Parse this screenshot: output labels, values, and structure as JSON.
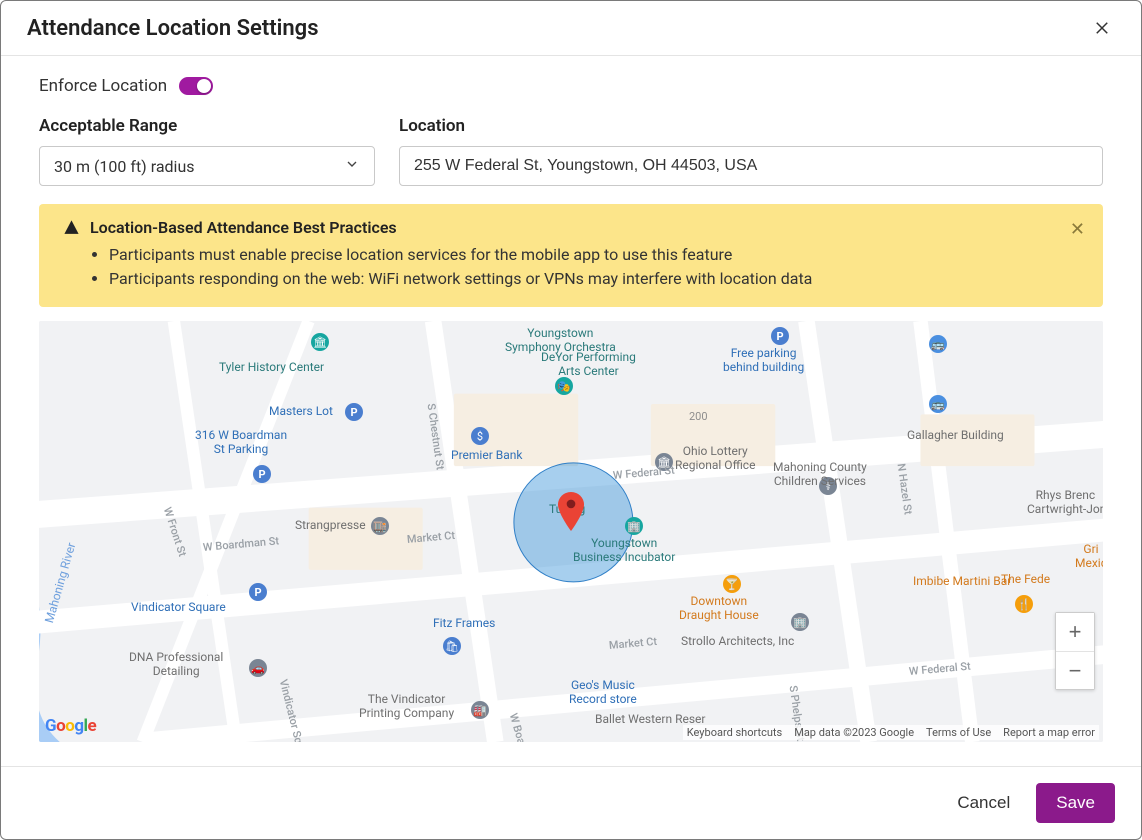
{
  "header": {
    "title": "Attendance Location Settings"
  },
  "toggle": {
    "label": "Enforce Location",
    "on": true
  },
  "fields": {
    "range_label": "Acceptable Range",
    "range_value": "30 m (100 ft) radius",
    "location_label": "Location",
    "location_value": "255 W Federal St, Youngstown, OH 44503, USA"
  },
  "alert": {
    "title": "Location-Based Attendance Best Practices",
    "bullets": [
      "Participants must enable precise location services for the mobile app to use this feature",
      "Participants responding on the web: WiFi network settings or VPNs may interfere with location data"
    ]
  },
  "map": {
    "zoom_in": "+",
    "zoom_out": "−",
    "attribution": {
      "shortcuts": "Keyboard shortcuts",
      "data": "Map data ©2023 Google",
      "terms": "Terms of Use",
      "report": "Report a map error"
    },
    "poi": {
      "symphony": "Youngstown\nSymphony Orchestra",
      "tyler": "Tyler History Center",
      "deyor": "DeYor Performing\nArts Center",
      "free_parking": "Free parking\nbehind building",
      "masters": "Masters Lot",
      "boardman": "316 W Boardman\nSt Parking",
      "premier": "Premier Bank",
      "lottery": "Ohio Lottery\nRegional Office",
      "mahoning": "Mahoning County\nChildren Services",
      "gallagher": "Gallagher Building",
      "rhys": "Rhys Brenc\nCartwright-Jor",
      "strang": "Strangpresse",
      "incubator": "Youngstown\nBusiness Incubator",
      "tubing": "Tubing",
      "vindicator_sq": "Vindicator Square",
      "fitz": "Fitz Frames",
      "draught": "Downtown\nDraught House",
      "strollo": "Strollo Architects, Inc",
      "imbibe": "Imbibe Martini Bar",
      "fede": "The Fede",
      "gri": "Gri\nMexic",
      "dna": "DNA Professional\nDetailing",
      "vindicator_print": "The Vindicator\nPrinting Company",
      "geos": "Geo's Music\nRecord store",
      "ballet": "Ballet Western Reser",
      "house_200": "200",
      "mahoning_river": "Mahoning River"
    },
    "streets": {
      "federal": "W Federal St",
      "federal2": "W Federal St",
      "boardman": "W Boardman St",
      "market": "Market Ct",
      "market2": "Market Ct",
      "front": "W Front St",
      "chestnut": "S Chestnut St",
      "hazel": "N Hazel St",
      "phelps": "S Phelps St",
      "vind_sq": "Vindicator Square",
      "boardman_ext": "W Boa"
    }
  },
  "footer": {
    "cancel": "Cancel",
    "save": "Save"
  }
}
